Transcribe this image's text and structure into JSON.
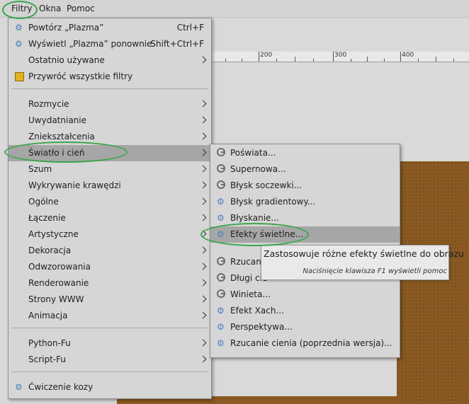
{
  "menubar": {
    "items": [
      {
        "label": "Filtry",
        "icon": null
      },
      {
        "label": "Okna",
        "icon": null
      },
      {
        "label": "Pomoc",
        "icon": null
      }
    ]
  },
  "ruler": {
    "labels": [
      "200",
      "300",
      "400"
    ]
  },
  "filters_menu": {
    "items": [
      {
        "label": "Powtórz „Plazma”",
        "shortcut": "Ctrl+F",
        "icon": "gegl-plasma-icon",
        "submenu": false
      },
      {
        "label": "Wyświetl „Plazma” ponownie",
        "shortcut": "Shift+Ctrl+F",
        "icon": "gegl-plasma-icon",
        "submenu": false
      },
      {
        "label": "Ostatnio używane",
        "shortcut": "",
        "icon": null,
        "submenu": true
      },
      {
        "label": "Przywróć wszystkie filtry",
        "shortcut": "",
        "icon": "reset-icon",
        "submenu": false
      },
      {
        "label": "Rozmycie",
        "shortcut": "",
        "icon": null,
        "submenu": true
      },
      {
        "label": "Uwydatnianie",
        "shortcut": "",
        "icon": null,
        "submenu": true
      },
      {
        "label": "Zniekształcenia",
        "shortcut": "",
        "icon": null,
        "submenu": true
      },
      {
        "label": "Światło i cień",
        "shortcut": "",
        "icon": null,
        "submenu": true
      },
      {
        "label": "Szum",
        "shortcut": "",
        "icon": null,
        "submenu": true
      },
      {
        "label": "Wykrywanie krawędzi",
        "shortcut": "",
        "icon": null,
        "submenu": true
      },
      {
        "label": "Ogólne",
        "shortcut": "",
        "icon": null,
        "submenu": true
      },
      {
        "label": "Łączenie",
        "shortcut": "",
        "icon": null,
        "submenu": true
      },
      {
        "label": "Artystyczne",
        "shortcut": "",
        "icon": null,
        "submenu": true
      },
      {
        "label": "Dekoracja",
        "shortcut": "",
        "icon": null,
        "submenu": true
      },
      {
        "label": "Odwzorowania",
        "shortcut": "",
        "icon": null,
        "submenu": true
      },
      {
        "label": "Renderowanie",
        "shortcut": "",
        "icon": null,
        "submenu": true
      },
      {
        "label": "Strony WWW",
        "shortcut": "",
        "icon": null,
        "submenu": true
      },
      {
        "label": "Animacja",
        "shortcut": "",
        "icon": null,
        "submenu": true
      },
      {
        "label": "Python-Fu",
        "shortcut": "",
        "icon": null,
        "submenu": true
      },
      {
        "label": "Script-Fu",
        "shortcut": "",
        "icon": null,
        "submenu": true
      },
      {
        "label": "Ćwiczenie kozy",
        "shortcut": "",
        "icon": "gegl-plasma-icon",
        "submenu": false
      }
    ],
    "highlighted": "Światło i cień"
  },
  "light_shadow_submenu": {
    "items": [
      {
        "label": "Poświata...",
        "icon": "gimp-script-icon"
      },
      {
        "label": "Supernowa...",
        "icon": "gimp-script-icon"
      },
      {
        "label": "Błysk soczewki...",
        "icon": "gimp-script-icon"
      },
      {
        "label": "Błysk gradientowy...",
        "icon": "gegl-plasma-icon"
      },
      {
        "label": "Błyskanie...",
        "icon": "gegl-plasma-icon"
      },
      {
        "label": "Efekty świetlne...",
        "icon": "gegl-plasma-icon"
      },
      {
        "label": "Rzucanie",
        "icon": "gimp-script-icon"
      },
      {
        "label": "Długi cie",
        "icon": "gimp-script-icon"
      },
      {
        "label": "Winieta...",
        "icon": "gimp-script-icon"
      },
      {
        "label": "Efekt Xach...",
        "icon": "gegl-plasma-icon"
      },
      {
        "label": "Perspektywa...",
        "icon": "gegl-plasma-icon"
      },
      {
        "label": "Rzucanie cienia (poprzednia wersja)...",
        "icon": "gegl-plasma-icon"
      }
    ],
    "highlighted": "Efekty świetlne..."
  },
  "tooltip": {
    "text": "Zastosowuje różne efekty świetlne do obrazu",
    "hint": "Naciśnięcie klawisza F1 wyświetli pomoc"
  },
  "colors": {
    "highlight": "#a6a6a6",
    "menu_bg": "#d6d6d6",
    "annotation": "#3aa648",
    "image": "#8a5a22"
  }
}
